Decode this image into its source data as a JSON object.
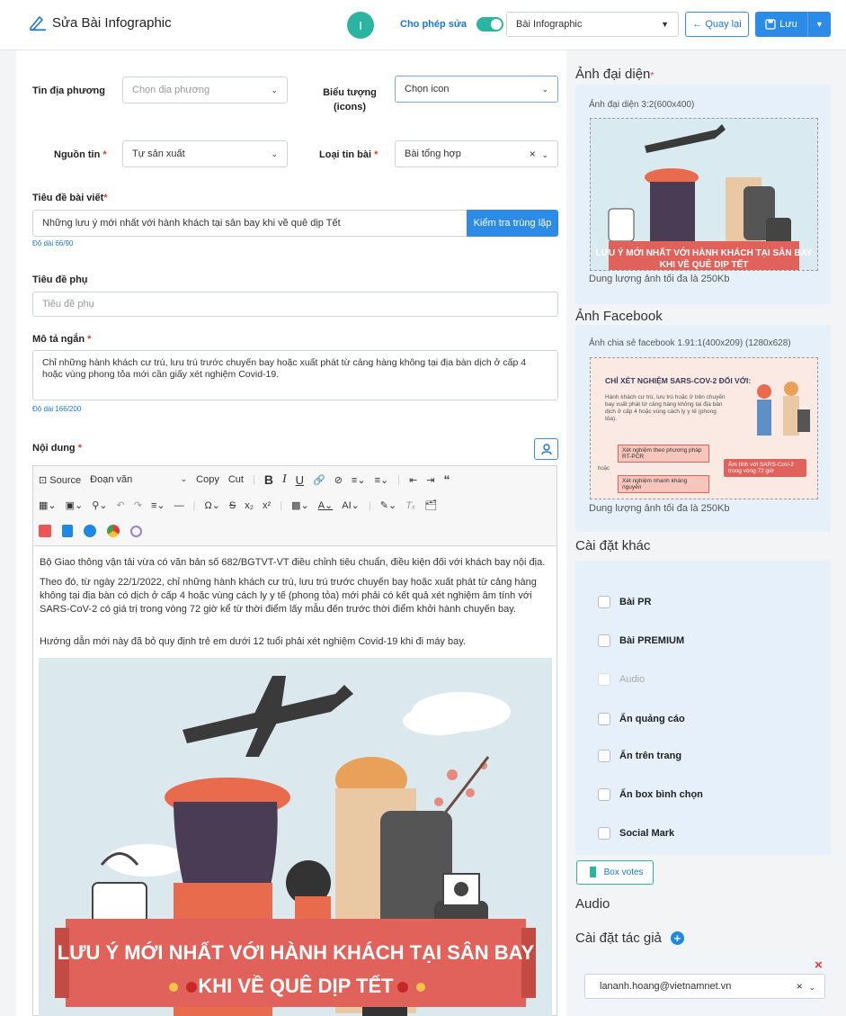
{
  "header": {
    "title": "Sửa Bài Infographic",
    "user_initial": "I",
    "allow_edit_label": "Cho phép sửa",
    "type_select": "Bài Infographic",
    "back_label": "← Quay lại",
    "save_label": "Lưu"
  },
  "form": {
    "local_news_label": "Tin địa phương",
    "local_news_placeholder": "Chọn địa phương",
    "icon_label": "Biểu tượng (icons)",
    "icon_placeholder": "Chọn icon",
    "source_label": "Nguồn tin",
    "source_value": "Tự sản xuất",
    "news_type_label": "Loại tin bài",
    "news_type_value": "Bài tổng hợp",
    "title_label": "Tiêu đề bài viết",
    "title_value": "Những lưu ý mới nhất với hành khách tại sân bay khi về quê dịp Tết",
    "check_dup_label": "Kiểm tra trùng lặp",
    "title_len": "Độ dài 66/90",
    "subtitle_label": "Tiêu đề phụ",
    "subtitle_placeholder": "Tiêu đề phụ",
    "summary_label": "Mô tả ngắn",
    "summary_value": "Chỉ những hành khách cư trú, lưu trú trước chuyến bay hoặc xuất phát từ cảng hàng không tại địa bàn dịch ở cấp 4 hoặc vùng phong tỏa mới cần giấy xét nghiệm Covid-19.",
    "summary_len": "Độ dài 166/200",
    "content_label": "Nội dung"
  },
  "editor": {
    "source": "Source",
    "paragraph": "Đoạn văn",
    "copy": "Copy",
    "cut": "Cut",
    "paragraphs": [
      "Bộ Giao thông vận tải vừa có văn bản số 682/BGTVT-VT điều chỉnh tiêu chuẩn, điều kiện đối với khách bay nội địa.",
      "Theo đó, từ ngày 22/1/2022, chỉ những hành khách cư trú, lưu trú trước chuyến bay hoặc xuất phát từ cảng hàng không tại địa bàn có dịch ở cấp 4 hoặc vùng cách ly y tế (phong tỏa) mới phải có kết quả xét nghiệm âm tính với SARS-CoV-2 có giá trị trong vòng 72 giờ kể từ thời điểm lấy mẫu đến trước thời điểm khởi hành chuyến bay.",
      "Hướng dẫn mới này đã bỏ quy định trẻ em dưới 12 tuổi phải xét nghiệm Covid-19 khi đi máy bay."
    ],
    "banner_line1": "LƯU Ý MỚI NHẤT VỚI HÀNH KHÁCH TẠI SÂN BAY",
    "banner_line2": "KHI VỀ QUÊ DỊP TẾT"
  },
  "sidebar": {
    "avatar_title": "Ảnh đại diện",
    "avatar_note": "Ảnh đại diện 3:2(600x400)",
    "avatar_size_note": "Dung lượng ảnh tối đa là 250Kb",
    "fb_title": "Ảnh Facebook",
    "fb_note": "Ảnh chia sẻ facebook 1.91:1(400x209) (1280x628)",
    "fb_size_note": "Dung lượng ảnh tối đa là 250Kb",
    "fb_img": {
      "heading": "CHỈ XÉT NGHIỆM SARS-COV-2 ĐỐI VỚI:",
      "body": "Hành khách cư trú, lưu trú hoặc ở trên chuyến bay xuất phát từ cảng hàng không tại địa bàn dịch ở cấp 4 hoặc vùng cách ly y tế (phong tỏa).",
      "box1": "Xét nghiệm theo phương pháp RT-PCR",
      "or": "hoặc",
      "box2": "Xét nghiệm nhanh kháng nguyên",
      "result": "Âm tính với SARS-CoV-2 trong vòng 72 giờ"
    },
    "other_title": "Cài đặt khác",
    "options": [
      "Bài PR",
      "Bài PREMIUM",
      "Audio",
      "Ẩn quảng cáo",
      "Ẩn trên trang",
      "Ẩn box bình chọn",
      "Social Mark"
    ],
    "box_votes": "Box votes",
    "audio_title": "Audio",
    "author_title": "Cài đặt tác giả",
    "author_value": "lananh.hoang@vietnamnet.vn"
  }
}
